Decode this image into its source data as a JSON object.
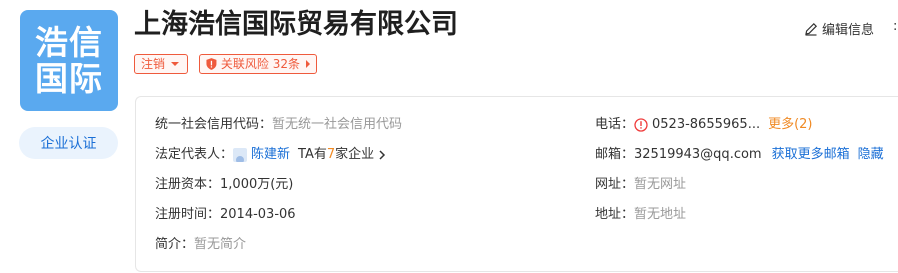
{
  "logo": {
    "line1": "浩信",
    "line2": "国际"
  },
  "cert_button": {
    "label": "企业认证"
  },
  "company": {
    "name": "上海浩信国际贸易有限公司"
  },
  "tags": {
    "status": "注销",
    "risk": "关联风险 32条"
  },
  "actions": {
    "edit": "编辑信息",
    "trailing": ":"
  },
  "info": {
    "credit_code": {
      "label": "统一社会信用代码：",
      "value": "暂无统一社会信用代码"
    },
    "legal_rep": {
      "label": "法定代表人：",
      "name": "陈建新",
      "ta_prefix": "TA有",
      "ta_count": "7",
      "ta_suffix": "家企业"
    },
    "capital": {
      "label": "注册资本：",
      "value": "1,000万(元)"
    },
    "reg_date": {
      "label": "注册时间：",
      "value": "2014-03-06"
    },
    "intro": {
      "label": "简介：",
      "value": "暂无简介"
    },
    "phone": {
      "label": "电话：",
      "value": "0523-8655965...",
      "more": "更多(2)"
    },
    "email": {
      "label": "邮箱：",
      "value": "32519943@qq.com",
      "more": "获取更多邮箱",
      "hide": "隐藏"
    },
    "website": {
      "label": "网址：",
      "value": "暂无网址"
    },
    "address": {
      "label": "地址：",
      "value": "暂无地址"
    }
  },
  "colors": {
    "logo_bg": "#5aa9ef",
    "tag_red": "#ef5a3c",
    "link_blue": "#1a6fd6",
    "more_orange": "#f08a24",
    "muted": "#999999"
  },
  "icons": {
    "edit": "pencil-icon",
    "risk": "shield-icon",
    "phone_alert": "alert-circle-icon",
    "legal_avatar": "avatar-icon"
  }
}
